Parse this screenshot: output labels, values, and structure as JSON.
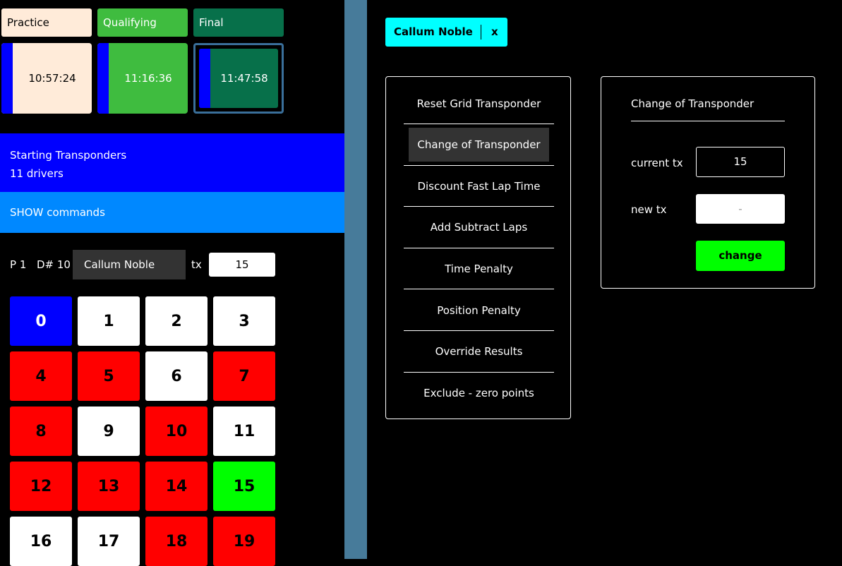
{
  "sessions": {
    "tabs": [
      {
        "label": "Practice",
        "bg": "#ffebd9",
        "fg": "#000000"
      },
      {
        "label": "Qualifying",
        "bg": "#3fbc3f",
        "fg": "#ffffff"
      },
      {
        "label": "Final",
        "bg": "#07704a",
        "fg": "#ffffff"
      }
    ],
    "times": [
      "10:57:24",
      "11:16:36",
      "11:47:58"
    ]
  },
  "transponders": {
    "title": "Starting Transponders",
    "count": "11 drivers"
  },
  "commands_label": "SHOW commands",
  "driver": {
    "position": "P 1",
    "number": "D# 10",
    "name": "Callum Noble",
    "tx_label": "tx",
    "tx_value": "15"
  },
  "grid": {
    "numbers": [
      "0",
      "1",
      "2",
      "3",
      "4",
      "5",
      "6",
      "7",
      "8",
      "9",
      "10",
      "11",
      "12",
      "13",
      "14",
      "15",
      "16",
      "17",
      "18",
      "19"
    ],
    "states": [
      "blue",
      "white",
      "white",
      "white",
      "red",
      "red",
      "white",
      "red",
      "red",
      "white",
      "red",
      "white",
      "red",
      "red",
      "red",
      "green",
      "white",
      "white",
      "red",
      "red"
    ]
  },
  "colors": {
    "blue": "#0000ff",
    "white": "#ffffff",
    "red": "#ff0000",
    "green": "#00ff00",
    "commands": "#0088ff",
    "divider": "#477b9a",
    "chip": "#00ffff"
  },
  "chip": {
    "name": "Callum Noble",
    "close": "x"
  },
  "menu": {
    "items": [
      "Reset Grid Transponder",
      "Change of Transponder",
      "Discount Fast Lap Time",
      "Add Subtract Laps",
      "Time Penalty",
      "Position Penalty",
      "Override Results",
      "Exclude - zero points"
    ],
    "selected": 1
  },
  "panel": {
    "title": "Change of Transponder",
    "current_label": "current tx",
    "current_value": "15",
    "new_label": "new tx",
    "new_placeholder": "-",
    "button": "change"
  }
}
